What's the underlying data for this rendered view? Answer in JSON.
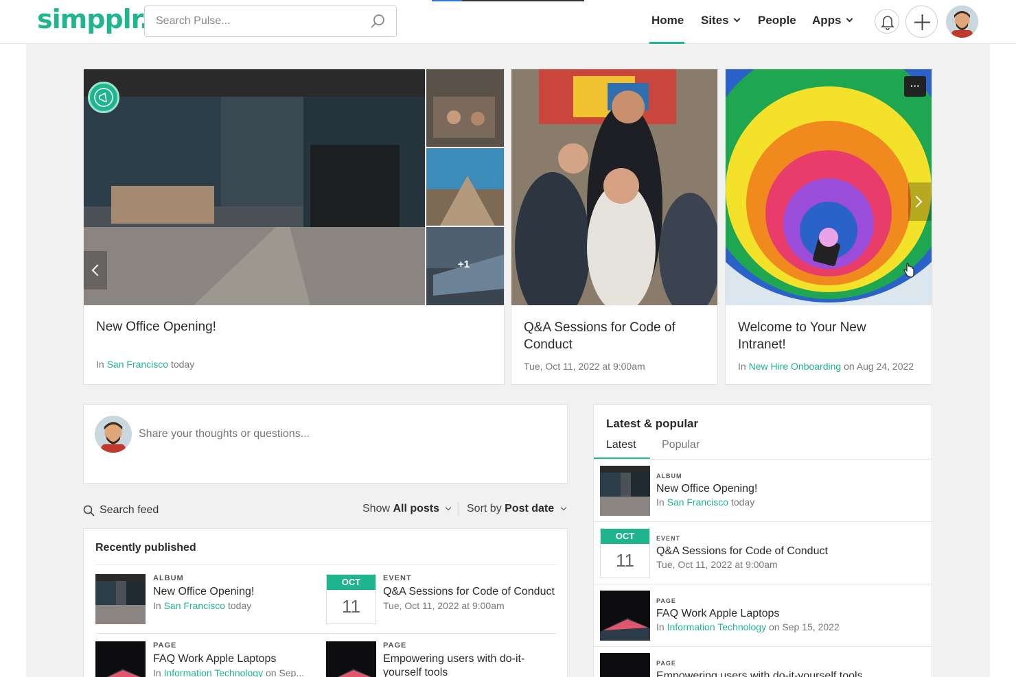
{
  "header": {
    "logo": "simpplr.",
    "search_placeholder": "Search Pulse...",
    "nav": [
      {
        "label": "Home"
      },
      {
        "label": "Sites"
      },
      {
        "label": "People"
      },
      {
        "label": "Apps"
      }
    ]
  },
  "featured": [
    {
      "title": "New Office Opening!",
      "meta_prefix": "In ",
      "meta_link": "San Francisco",
      "meta_suffix": " today",
      "more_count": "+1"
    },
    {
      "title": "Q&A Sessions for Code of Conduct",
      "meta": "Tue, Oct 11, 2022 at 9:00am"
    },
    {
      "title": "Welcome to Your New Intranet!",
      "meta_prefix": "In ",
      "meta_link": "New Hire Onboarding",
      "meta_suffix": " on Aug 24, 2022",
      "menu": "···"
    }
  ],
  "composer": {
    "placeholder": "Share your thoughts or questions..."
  },
  "feed": {
    "search_label": "Search feed",
    "show_prefix": "Show ",
    "show_value": "All posts",
    "sort_prefix": "Sort by ",
    "sort_value": "Post date",
    "recent_title": "Recently published",
    "items": [
      {
        "label": "ALBUM",
        "title": "New Office Opening!",
        "meta_prefix": "In ",
        "meta_link": "San Francisco",
        "meta_suffix": " today"
      },
      {
        "label": "EVENT",
        "title": "Q&A Sessions for Code of Conduct",
        "meta": "Tue, Oct 11, 2022 at 9:00am",
        "cal_month": "OCT",
        "cal_day": "11"
      },
      {
        "label": "PAGE",
        "title": "FAQ Work Apple Laptops",
        "meta_prefix": "In ",
        "meta_link": "Information Technology",
        "meta_suffix": " on Sep..."
      },
      {
        "label": "PAGE",
        "title": "Empowering users with do-it-yourself tools"
      }
    ]
  },
  "latest": {
    "title": "Latest & popular",
    "tabs": [
      {
        "label": "Latest"
      },
      {
        "label": "Popular"
      }
    ],
    "items": [
      {
        "label": "ALBUM",
        "title": "New Office Opening!",
        "meta_prefix": "In ",
        "meta_link": "San Francisco",
        "meta_suffix": " today"
      },
      {
        "label": "EVENT",
        "title": "Q&A Sessions for Code of Conduct",
        "meta": "Tue, Oct 11, 2022 at 9:00am",
        "cal_month": "OCT",
        "cal_day": "11"
      },
      {
        "label": "PAGE",
        "title": "FAQ Work Apple Laptops",
        "meta_prefix": "In ",
        "meta_link": "Information Technology",
        "meta_suffix": " on Sep 15, 2022"
      },
      {
        "label": "PAGE",
        "title": "Empowering users with do-it-yourself tools"
      }
    ]
  }
}
